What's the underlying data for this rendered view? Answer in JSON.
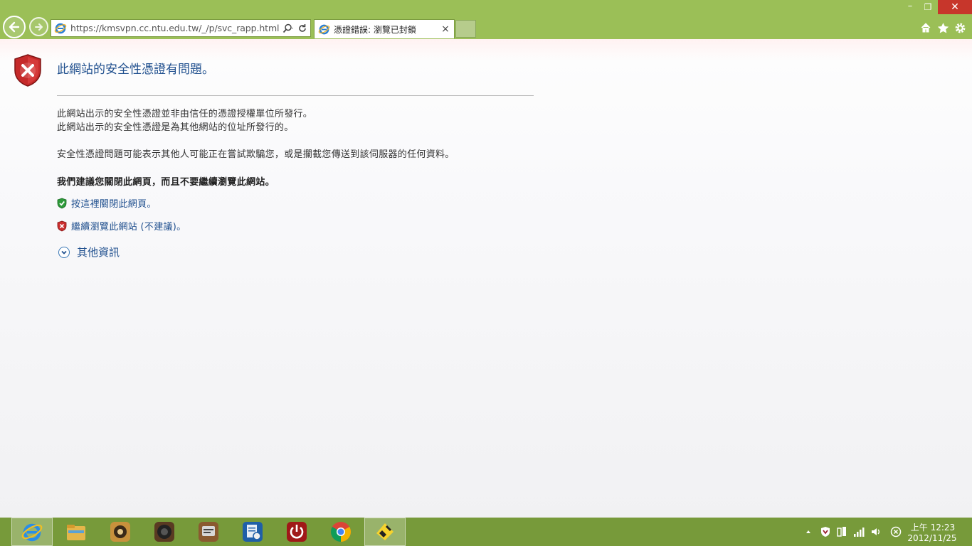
{
  "browser": {
    "address_url": "https://kmsvpn.cc.ntu.edu.tw/_/p/svc_rapp.html",
    "tab_title": "憑證錯誤: 瀏覽已封鎖",
    "tab_close": "×",
    "window_min": "–",
    "window_restore": "❐",
    "window_close": "✕"
  },
  "page": {
    "title": "此網站的安全性憑證有問題。",
    "line1": "此網站出示的安全性憑證並非由信任的憑證授權單位所發行。",
    "line2": "此網站出示的安全性憑證是為其他網站的位址所發行的。",
    "line3": "安全性憑證問題可能表示其他人可能正在嘗試欺騙您，或是攔截您傳送到該伺服器的任何資料。",
    "recommend": "我們建議您關閉此網頁，而且不要繼續瀏覽此網站。",
    "close_link": "按這裡關閉此網頁。",
    "continue_link": "繼續瀏覽此網站 (不建議)。",
    "more_info": "其他資訊"
  },
  "taskbar": {
    "apps": [
      "internet-explorer",
      "file-explorer",
      "media-player",
      "speaker",
      "doc-viewer",
      "system-tool",
      "power",
      "chrome",
      "app-yellow"
    ],
    "clock_time": "上午 12:23",
    "clock_date": "2012/11/25"
  },
  "colors": {
    "chrome_bg": "#9bbf57",
    "taskbar_bg": "#779a3a",
    "link": "#1f4f8e",
    "close_red": "#c7362b"
  }
}
